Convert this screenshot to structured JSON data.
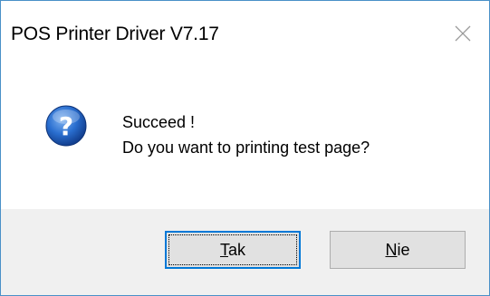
{
  "window": {
    "title": "POS Printer Driver V7.17"
  },
  "icons": {
    "close": "close-icon",
    "question": "question-icon"
  },
  "message": {
    "line1": "Succeed !",
    "line2": "Do you want to printing test page?"
  },
  "buttons": {
    "yes": {
      "mnemonic": "T",
      "rest": "ak"
    },
    "no": {
      "mnemonic": "N",
      "rest": "ie"
    }
  },
  "colors": {
    "window_border": "#4a90c8",
    "footer_bg": "#f0f0f0",
    "button_bg": "#e1e1e1",
    "default_button_border": "#0078d7",
    "icon_blue": "#1f5fbf"
  }
}
